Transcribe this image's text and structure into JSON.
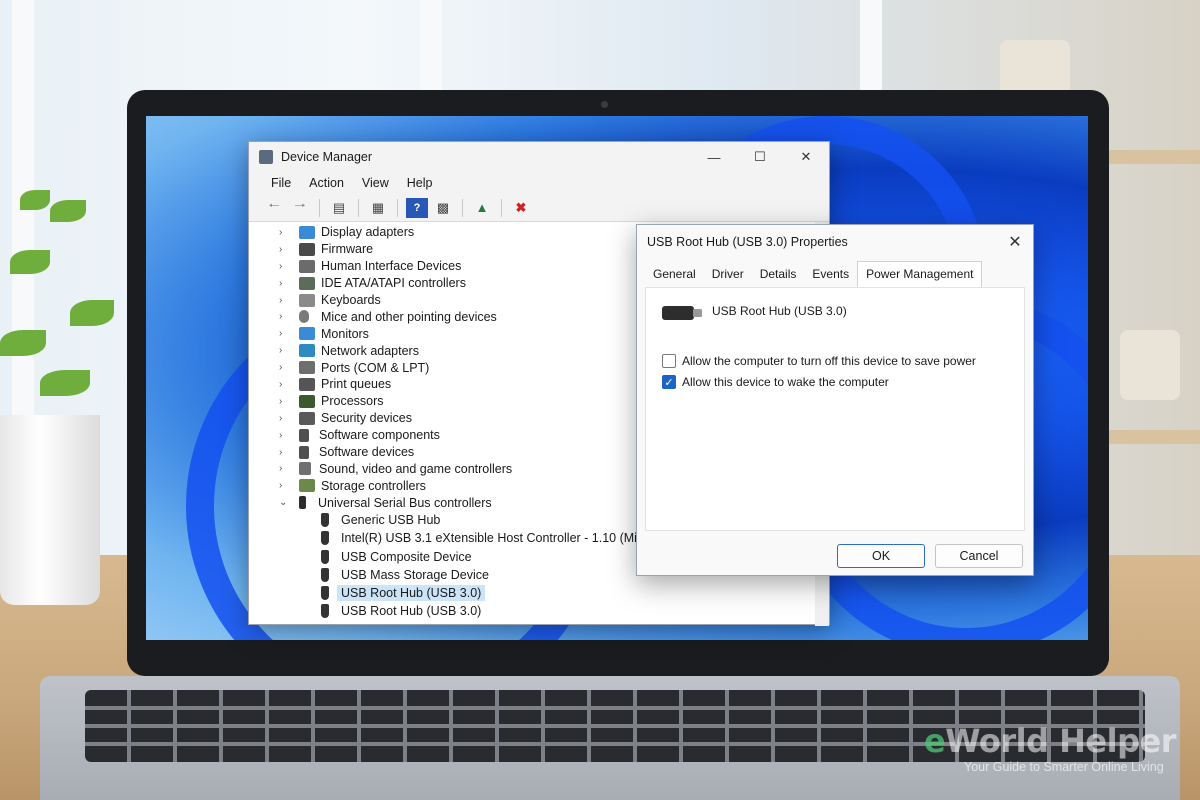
{
  "device_manager": {
    "title": "Device Manager",
    "menu": [
      "File",
      "Action",
      "View",
      "Help"
    ],
    "categories": [
      "Display adapters",
      "Firmware",
      "Human Interface Devices",
      "IDE ATA/ATAPI controllers",
      "Keyboards",
      "Mice and other pointing devices",
      "Monitors",
      "Network adapters",
      "Ports (COM & LPT)",
      "Print queues",
      "Processors",
      "Security devices",
      "Software components",
      "Software devices",
      "Sound, video and game controllers",
      "Storage controllers"
    ],
    "expanded_category": "Universal Serial Bus controllers",
    "usb_devices": [
      "Generic USB Hub",
      "Intel(R) USB 3.1 eXtensible Host Controller - 1.10 (Mi",
      "USB Composite Device",
      "USB Mass Storage Device",
      "USB Root Hub (USB 3.0)",
      "USB Root Hub (USB 3.0)"
    ],
    "selected_index": 4
  },
  "properties_dialog": {
    "title": "USB Root Hub (USB 3.0) Properties",
    "tabs": [
      "General",
      "Driver",
      "Details",
      "Events",
      "Power Management"
    ],
    "active_tab": "Power Management",
    "device_name": "USB Root Hub (USB 3.0)",
    "option_power_save": "Allow the computer to turn off this device to save power",
    "option_power_save_checked": false,
    "option_wake": "Allow this device to wake the computer",
    "option_wake_checked": true,
    "ok_label": "OK",
    "cancel_label": "Cancel"
  },
  "watermark": {
    "brand": "eWorld Helper",
    "tagline": "Your Guide to Smarter Online Living"
  },
  "colors": {
    "selection": "#cce4f7",
    "checkbox_checked": "#1a64c8",
    "wallpaper_blue": "#1452e6"
  }
}
